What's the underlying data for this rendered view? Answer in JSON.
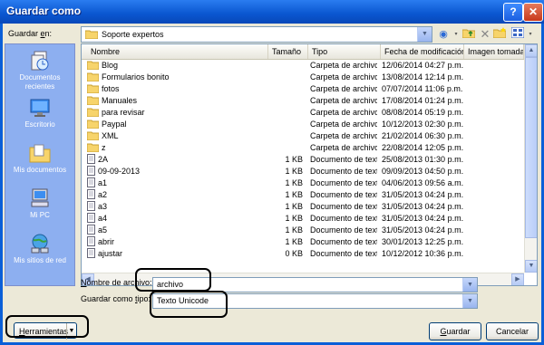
{
  "window": {
    "title": "Guardar como",
    "help": "?",
    "close": "✕"
  },
  "lookin": {
    "label_prefix": "Guardar ",
    "label_accel": "e",
    "label_suffix": "n:",
    "value": "Soporte expertos"
  },
  "places": [
    {
      "label": "Documentos recientes",
      "icon": "recent-documents-icon"
    },
    {
      "label": "Escritorio",
      "icon": "desktop-icon"
    },
    {
      "label": "Mis documentos",
      "icon": "my-documents-icon"
    },
    {
      "label": "Mi PC",
      "icon": "my-computer-icon"
    },
    {
      "label": "Mis sitios de red",
      "icon": "network-places-icon"
    }
  ],
  "columns": [
    "Nombre",
    "Tamaño",
    "Tipo",
    "Fecha de modificación",
    "Imagen tomada e"
  ],
  "files": [
    {
      "name": "Blog",
      "size": "",
      "type": "Carpeta de archivo",
      "date": "12/06/2014 04:27 p.m.",
      "kind": "folder"
    },
    {
      "name": "Formularios bonito",
      "size": "",
      "type": "Carpeta de archivo",
      "date": "13/08/2014 12:14 p.m.",
      "kind": "folder"
    },
    {
      "name": "fotos",
      "size": "",
      "type": "Carpeta de archivo",
      "date": "07/07/2014 11:06 p.m.",
      "kind": "folder"
    },
    {
      "name": "Manuales",
      "size": "",
      "type": "Carpeta de archivo",
      "date": "17/08/2014 01:24 p.m.",
      "kind": "folder"
    },
    {
      "name": "para revisar",
      "size": "",
      "type": "Carpeta de archivo",
      "date": "08/08/2014 05:19 p.m.",
      "kind": "folder"
    },
    {
      "name": "Paypal",
      "size": "",
      "type": "Carpeta de archivo",
      "date": "10/12/2013 02:30 p.m.",
      "kind": "folder"
    },
    {
      "name": "XML",
      "size": "",
      "type": "Carpeta de archivo",
      "date": "21/02/2014 06:30 p.m.",
      "kind": "folder"
    },
    {
      "name": "z",
      "size": "",
      "type": "Carpeta de archivo",
      "date": "22/08/2014 12:05 p.m.",
      "kind": "folder"
    },
    {
      "name": "2A",
      "size": "1 KB",
      "type": "Documento de texto",
      "date": "25/08/2013 01:30 p.m.",
      "kind": "file"
    },
    {
      "name": "09-09-2013",
      "size": "1 KB",
      "type": "Documento de texto",
      "date": "09/09/2013 04:50 p.m.",
      "kind": "file"
    },
    {
      "name": "a1",
      "size": "1 KB",
      "type": "Documento de texto",
      "date": "04/06/2013 09:56 a.m.",
      "kind": "file"
    },
    {
      "name": "a2",
      "size": "1 KB",
      "type": "Documento de texto",
      "date": "31/05/2013 04:24 p.m.",
      "kind": "file"
    },
    {
      "name": "a3",
      "size": "1 KB",
      "type": "Documento de texto",
      "date": "31/05/2013 04:24 p.m.",
      "kind": "file"
    },
    {
      "name": "a4",
      "size": "1 KB",
      "type": "Documento de texto",
      "date": "31/05/2013 04:24 p.m.",
      "kind": "file"
    },
    {
      "name": "a5",
      "size": "1 KB",
      "type": "Documento de texto",
      "date": "31/05/2013 04:24 p.m.",
      "kind": "file"
    },
    {
      "name": "abrir",
      "size": "1 KB",
      "type": "Documento de texto",
      "date": "30/01/2013 12:25 p.m.",
      "kind": "file"
    },
    {
      "name": "ajustar",
      "size": "0 KB",
      "type": "Documento de texto",
      "date": "10/12/2012 10:36 p.m.",
      "kind": "file"
    }
  ],
  "filename": {
    "label_accel": "N",
    "label_suffix": "ombre de archivo:",
    "value": "archivo"
  },
  "filetype": {
    "label_prefix": "Guardar como ",
    "label_accel": "t",
    "label_suffix": "ipo:",
    "value": "Texto Unicode"
  },
  "buttons": {
    "save_accel": "G",
    "save_suffix": "uardar",
    "cancel": "Cancelar",
    "tools_accel": "H",
    "tools_suffix": "erramientas"
  },
  "colors": {
    "titlebar": "#0a56d0",
    "places_bar": "#8daff0",
    "dialog_bg": "#ece9d8"
  }
}
